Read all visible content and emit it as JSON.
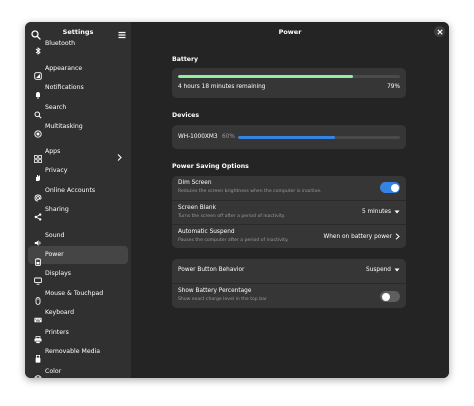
{
  "sidebar": {
    "title": "Settings",
    "items": [
      {
        "label": "Bluetooth",
        "icon": "bluetooth-icon"
      },
      {
        "label": "Appearance",
        "icon": "appearance-icon"
      },
      {
        "label": "Notifications",
        "icon": "bell-icon"
      },
      {
        "label": "Search",
        "icon": "search-icon"
      },
      {
        "label": "Multitasking",
        "icon": "multitasking-icon"
      },
      {
        "label": "Apps",
        "icon": "apps-icon"
      },
      {
        "label": "Privacy",
        "icon": "hand-icon"
      },
      {
        "label": "Online Accounts",
        "icon": "at-icon"
      },
      {
        "label": "Sharing",
        "icon": "share-icon"
      },
      {
        "label": "Sound",
        "icon": "speaker-icon"
      },
      {
        "label": "Power",
        "icon": "power-icon"
      },
      {
        "label": "Displays",
        "icon": "display-icon"
      },
      {
        "label": "Mouse & Touchpad",
        "icon": "mouse-icon"
      },
      {
        "label": "Keyboard",
        "icon": "keyboard-icon"
      },
      {
        "label": "Printers",
        "icon": "printer-icon"
      },
      {
        "label": "Removable Media",
        "icon": "usb-icon"
      },
      {
        "label": "Color",
        "icon": "color-icon"
      }
    ],
    "selected": "Power"
  },
  "main": {
    "title": "Power",
    "battery": {
      "section_label": "Battery",
      "remaining_text": "4 hours 18 minutes remaining",
      "percent_text": "79%",
      "level": 0.79
    },
    "devices": {
      "section_label": "Devices",
      "device_name": "WH-1000XM3",
      "percent_text": "60%",
      "level": 0.6
    },
    "power_saving": {
      "section_label": "Power Saving Options",
      "dim_screen": {
        "title": "Dim Screen",
        "subtitle": "Reduces the screen brightness when the computer is inactive.",
        "enabled": true
      },
      "screen_blank": {
        "title": "Screen Blank",
        "subtitle": "Turns the screen off after a period of inactivity.",
        "value": "5 minutes"
      },
      "automatic_suspend": {
        "title": "Automatic Suspend",
        "subtitle": "Pauses the computer after a period of inactivity.",
        "value": "When on battery power"
      }
    },
    "general": {
      "power_button": {
        "title": "Power Button Behavior",
        "value": "Suspend"
      },
      "show_percentage": {
        "title": "Show Battery Percentage",
        "subtitle": "Show exact charge level in the top bar",
        "enabled": false
      }
    }
  },
  "colors": {
    "battery_green": "#8ff0a4",
    "accent_blue": "#3584e4",
    "toggle_off": "#5e5e5e"
  }
}
